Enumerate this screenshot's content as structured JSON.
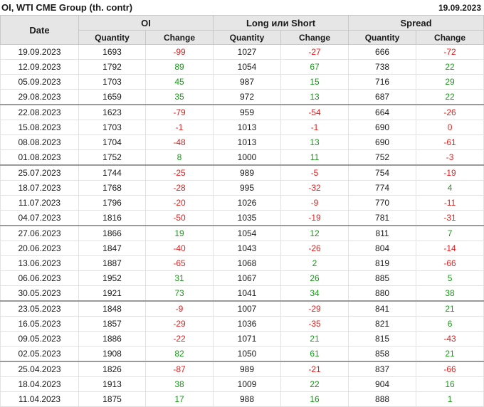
{
  "header": {
    "title": "OI, WTI CME Group (th. contr)",
    "date": "19.09.2023"
  },
  "columns": {
    "date": "Date",
    "groups": [
      "OI",
      "Long или Short",
      "Spread"
    ],
    "quantity": "Quantity",
    "change": "Change"
  },
  "colors": {
    "positive": "#1a9a1a",
    "negative": "#e02020",
    "header_bg": "#e6e6e6"
  },
  "rows": [
    {
      "date": "19.09.2023",
      "oi": "1693",
      "oi_chg": "-99",
      "ls": "1027",
      "ls_chg": "-27",
      "sp": "666",
      "sp_chg": "-72"
    },
    {
      "date": "12.09.2023",
      "oi": "1792",
      "oi_chg": "89",
      "ls": "1054",
      "ls_chg": "67",
      "sp": "738",
      "sp_chg": "22"
    },
    {
      "date": "05.09.2023",
      "oi": "1703",
      "oi_chg": "45",
      "ls": "987",
      "ls_chg": "15",
      "sp": "716",
      "sp_chg": "29"
    },
    {
      "date": "29.08.2023",
      "oi": "1659",
      "oi_chg": "35",
      "ls": "972",
      "ls_chg": "13",
      "sp": "687",
      "sp_chg": "22"
    },
    {
      "date": "22.08.2023",
      "oi": "1623",
      "oi_chg": "-79",
      "ls": "959",
      "ls_chg": "-54",
      "sp": "664",
      "sp_chg": "-26",
      "sep": true
    },
    {
      "date": "15.08.2023",
      "oi": "1703",
      "oi_chg": "-1",
      "ls": "1013",
      "ls_chg": "-1",
      "sp": "690",
      "sp_chg": "0"
    },
    {
      "date": "08.08.2023",
      "oi": "1704",
      "oi_chg": "-48",
      "ls": "1013",
      "ls_chg": "13",
      "sp": "690",
      "sp_chg": "-61"
    },
    {
      "date": "01.08.2023",
      "oi": "1752",
      "oi_chg": "8",
      "ls": "1000",
      "ls_chg": "11",
      "sp": "752",
      "sp_chg": "-3"
    },
    {
      "date": "25.07.2023",
      "oi": "1744",
      "oi_chg": "-25",
      "ls": "989",
      "ls_chg": "-5",
      "sp": "754",
      "sp_chg": "-19",
      "sep": true
    },
    {
      "date": "18.07.2023",
      "oi": "1768",
      "oi_chg": "-28",
      "ls": "995",
      "ls_chg": "-32",
      "sp": "774",
      "sp_chg": "4"
    },
    {
      "date": "11.07.2023",
      "oi": "1796",
      "oi_chg": "-20",
      "ls": "1026",
      "ls_chg": "-9",
      "sp": "770",
      "sp_chg": "-11"
    },
    {
      "date": "04.07.2023",
      "oi": "1816",
      "oi_chg": "-50",
      "ls": "1035",
      "ls_chg": "-19",
      "sp": "781",
      "sp_chg": "-31"
    },
    {
      "date": "27.06.2023",
      "oi": "1866",
      "oi_chg": "19",
      "ls": "1054",
      "ls_chg": "12",
      "sp": "811",
      "sp_chg": "7",
      "sep": true
    },
    {
      "date": "20.06.2023",
      "oi": "1847",
      "oi_chg": "-40",
      "ls": "1043",
      "ls_chg": "-26",
      "sp": "804",
      "sp_chg": "-14"
    },
    {
      "date": "13.06.2023",
      "oi": "1887",
      "oi_chg": "-65",
      "ls": "1068",
      "ls_chg": "2",
      "sp": "819",
      "sp_chg": "-66"
    },
    {
      "date": "06.06.2023",
      "oi": "1952",
      "oi_chg": "31",
      "ls": "1067",
      "ls_chg": "26",
      "sp": "885",
      "sp_chg": "5"
    },
    {
      "date": "30.05.2023",
      "oi": "1921",
      "oi_chg": "73",
      "ls": "1041",
      "ls_chg": "34",
      "sp": "880",
      "sp_chg": "38"
    },
    {
      "date": "23.05.2023",
      "oi": "1848",
      "oi_chg": "-9",
      "ls": "1007",
      "ls_chg": "-29",
      "sp": "841",
      "sp_chg": "21",
      "sep": true
    },
    {
      "date": "16.05.2023",
      "oi": "1857",
      "oi_chg": "-29",
      "ls": "1036",
      "ls_chg": "-35",
      "sp": "821",
      "sp_chg": "6"
    },
    {
      "date": "09.05.2023",
      "oi": "1886",
      "oi_chg": "-22",
      "ls": "1071",
      "ls_chg": "21",
      "sp": "815",
      "sp_chg": "-43"
    },
    {
      "date": "02.05.2023",
      "oi": "1908",
      "oi_chg": "82",
      "ls": "1050",
      "ls_chg": "61",
      "sp": "858",
      "sp_chg": "21"
    },
    {
      "date": "25.04.2023",
      "oi": "1826",
      "oi_chg": "-87",
      "ls": "989",
      "ls_chg": "-21",
      "sp": "837",
      "sp_chg": "-66",
      "sep": true
    },
    {
      "date": "18.04.2023",
      "oi": "1913",
      "oi_chg": "38",
      "ls": "1009",
      "ls_chg": "22",
      "sp": "904",
      "sp_chg": "16"
    },
    {
      "date": "11.04.2023",
      "oi": "1875",
      "oi_chg": "17",
      "ls": "988",
      "ls_chg": "16",
      "sp": "888",
      "sp_chg": "1"
    }
  ]
}
